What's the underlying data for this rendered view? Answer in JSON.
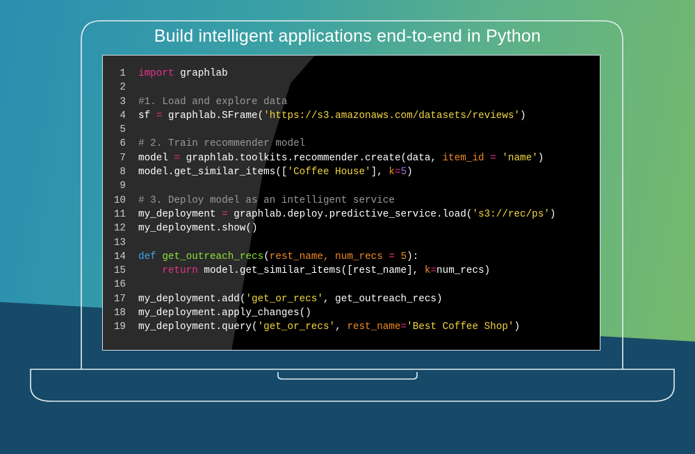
{
  "headline": "Build intelligent applications end-to-end in Python",
  "code": {
    "line_numbers": [
      "1",
      "2",
      "3",
      "4",
      "5",
      "6",
      "7",
      "8",
      "9",
      "10",
      "11",
      "12",
      "13",
      "14",
      "15",
      "16",
      "17",
      "18",
      "19"
    ],
    "lines": [
      [
        {
          "t": "import",
          "c": "kw"
        },
        {
          "t": " graphlab",
          "c": ""
        }
      ],
      [],
      [
        {
          "t": "#1. Load and explore data",
          "c": "cm"
        }
      ],
      [
        {
          "t": "sf ",
          "c": ""
        },
        {
          "t": "=",
          "c": "op"
        },
        {
          "t": " graphlab.SFrame(",
          "c": ""
        },
        {
          "t": "'https://s3.amazonaws.com/datasets/reviews'",
          "c": "str"
        },
        {
          "t": ")",
          "c": ""
        }
      ],
      [],
      [
        {
          "t": "# 2. Train recommender model",
          "c": "cm"
        }
      ],
      [
        {
          "t": "model ",
          "c": ""
        },
        {
          "t": "=",
          "c": "op"
        },
        {
          "t": " graphlab.toolkits.recommender.create(data, ",
          "c": ""
        },
        {
          "t": "item_id",
          "c": "prm"
        },
        {
          "t": " ",
          "c": ""
        },
        {
          "t": "=",
          "c": "op"
        },
        {
          "t": " ",
          "c": ""
        },
        {
          "t": "'name'",
          "c": "str"
        },
        {
          "t": ")",
          "c": ""
        }
      ],
      [
        {
          "t": "model.get_similar_items([",
          "c": ""
        },
        {
          "t": "'Coffee House'",
          "c": "str"
        },
        {
          "t": "], ",
          "c": ""
        },
        {
          "t": "k",
          "c": "prm"
        },
        {
          "t": "=",
          "c": "op"
        },
        {
          "t": "5",
          "c": "prm2"
        },
        {
          "t": ")",
          "c": ""
        }
      ],
      [],
      [
        {
          "t": "# 3. Deploy model as an intelligent service",
          "c": "cm"
        }
      ],
      [
        {
          "t": "my_deployment ",
          "c": ""
        },
        {
          "t": "=",
          "c": "op"
        },
        {
          "t": " graphlab.deploy.predictive_service.load(",
          "c": ""
        },
        {
          "t": "'s3://rec/ps'",
          "c": "str"
        },
        {
          "t": ")",
          "c": ""
        }
      ],
      [
        {
          "t": "my_deployment.show()",
          "c": ""
        }
      ],
      [],
      [
        {
          "t": "def",
          "c": "kwb"
        },
        {
          "t": " ",
          "c": ""
        },
        {
          "t": "get_outreach_recs",
          "c": "fn"
        },
        {
          "t": "(",
          "c": ""
        },
        {
          "t": "rest_name, num_recs ",
          "c": "prm"
        },
        {
          "t": "=",
          "c": "op"
        },
        {
          "t": " 5",
          "c": "prm"
        },
        {
          "t": "):",
          "c": ""
        }
      ],
      [
        {
          "t": "    ",
          "c": ""
        },
        {
          "t": "return",
          "c": "kw"
        },
        {
          "t": " model.get_similar_items([rest_name], ",
          "c": ""
        },
        {
          "t": "k",
          "c": "prm"
        },
        {
          "t": "=",
          "c": "op"
        },
        {
          "t": "num_recs)",
          "c": ""
        }
      ],
      [],
      [
        {
          "t": "my_deployment.add(",
          "c": ""
        },
        {
          "t": "'get_or_recs'",
          "c": "str"
        },
        {
          "t": ", get_outreach_recs)",
          "c": ""
        }
      ],
      [
        {
          "t": "my_deployment.apply_changes()",
          "c": ""
        }
      ],
      [
        {
          "t": "my_deployment.query(",
          "c": ""
        },
        {
          "t": "'get_or_recs'",
          "c": "str"
        },
        {
          "t": ", ",
          "c": ""
        },
        {
          "t": "rest_name",
          "c": "prm"
        },
        {
          "t": "=",
          "c": "op"
        },
        {
          "t": "'Best Coffee Shop'",
          "c": "str"
        },
        {
          "t": ")",
          "c": ""
        }
      ]
    ]
  },
  "colors": {
    "keyword": "#e8318e",
    "def_keyword": "#39a6e6",
    "function_name": "#8ee03a",
    "string": "#f3d641",
    "comment": "#9a9a9a",
    "parameter": "#f08a24",
    "number": "#a46fe0"
  }
}
